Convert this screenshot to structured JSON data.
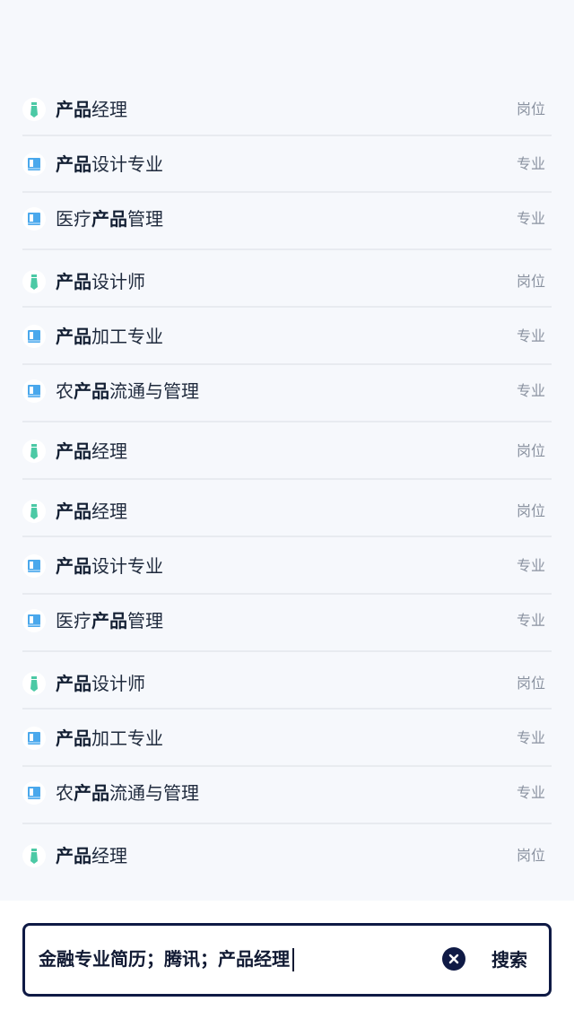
{
  "suggestions": [
    {
      "prefix": "",
      "highlight": "产品",
      "suffix": "经理",
      "type": "岗位",
      "icon": "tie-icon",
      "kind": "position"
    },
    {
      "prefix": "",
      "highlight": "产品",
      "suffix": "设计专业",
      "type": "专业",
      "icon": "book-icon",
      "kind": "major"
    },
    {
      "prefix": "医疗",
      "highlight": "产品",
      "suffix": "管理",
      "type": "专业",
      "icon": "book-icon",
      "kind": "major"
    },
    {
      "prefix": "",
      "highlight": "产品",
      "suffix": "设计师",
      "type": "岗位",
      "icon": "tie-icon",
      "kind": "position"
    },
    {
      "prefix": "",
      "highlight": "产品",
      "suffix": "加工专业",
      "type": "专业",
      "icon": "book-icon",
      "kind": "major"
    },
    {
      "prefix": "农",
      "highlight": "产品",
      "suffix": "流通与管理",
      "type": "专业",
      "icon": "book-icon",
      "kind": "major"
    },
    {
      "prefix": "",
      "highlight": "产品",
      "suffix": "经理",
      "type": "岗位",
      "icon": "tie-icon",
      "kind": "position"
    },
    {
      "prefix": "",
      "highlight": "产品",
      "suffix": "经理",
      "type": "岗位",
      "icon": "tie-icon",
      "kind": "position"
    },
    {
      "prefix": "",
      "highlight": "产品",
      "suffix": "设计专业",
      "type": "专业",
      "icon": "book-icon",
      "kind": "major"
    },
    {
      "prefix": "医疗",
      "highlight": "产品",
      "suffix": "管理",
      "type": "专业",
      "icon": "book-icon",
      "kind": "major"
    },
    {
      "prefix": "",
      "highlight": "产品",
      "suffix": "设计师",
      "type": "岗位",
      "icon": "tie-icon",
      "kind": "position"
    },
    {
      "prefix": "",
      "highlight": "产品",
      "suffix": "加工专业",
      "type": "专业",
      "icon": "book-icon",
      "kind": "major"
    },
    {
      "prefix": "农",
      "highlight": "产品",
      "suffix": "流通与管理",
      "type": "专业",
      "icon": "book-icon",
      "kind": "major"
    },
    {
      "prefix": "",
      "highlight": "产品",
      "suffix": "经理",
      "type": "岗位",
      "icon": "tie-icon",
      "kind": "position"
    }
  ],
  "search": {
    "query": "金融专业简历；腾讯；产品经理",
    "clear_icon": "clear-icon",
    "button_label": "搜索"
  },
  "colors": {
    "accent": "#0f1a45",
    "tie_green": "#4cc9a5",
    "book_blue": "#4aa8ec",
    "background": "#f6f8fc"
  }
}
